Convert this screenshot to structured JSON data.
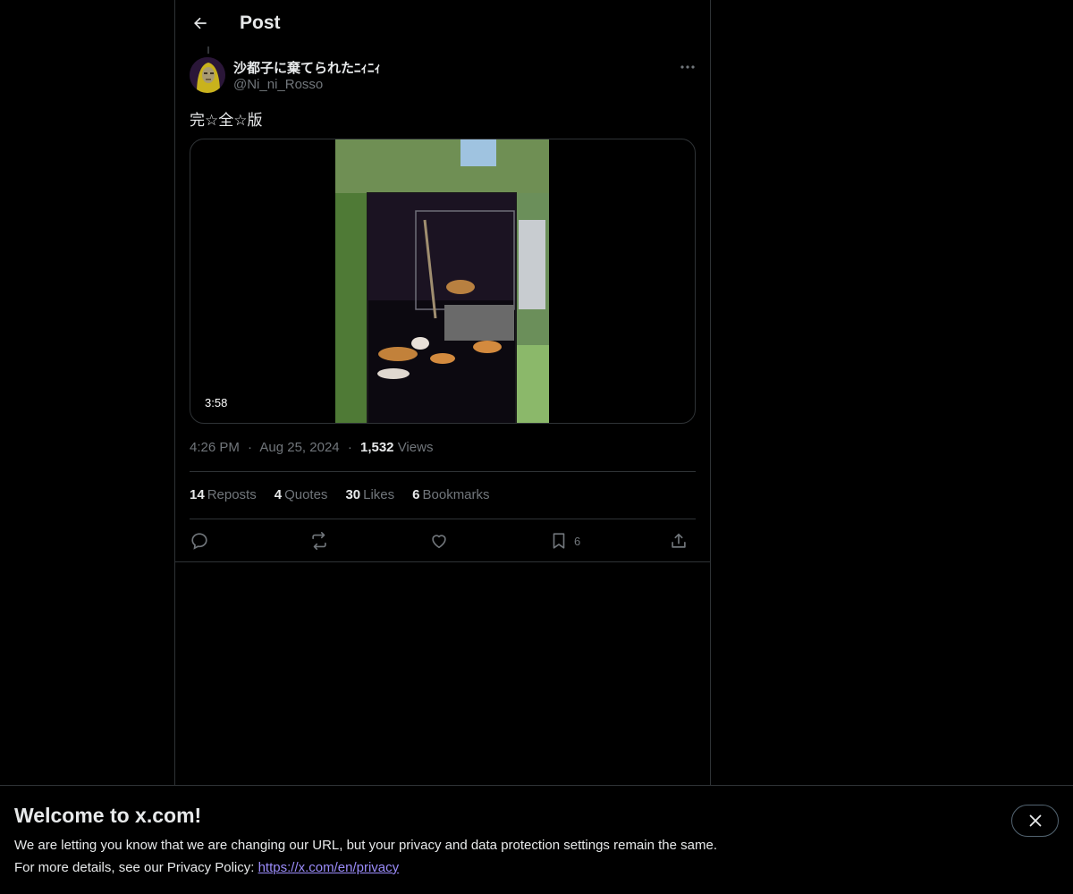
{
  "header": {
    "title": "Post",
    "back_icon": "arrow-left-icon"
  },
  "post": {
    "author_name": "沙都子に棄てられたﾆｨﾆｨ",
    "author_handle": "@Ni_ni_Rosso",
    "text": "完☆全☆版",
    "video_duration": "3:58",
    "time": "4:26 PM",
    "date": "Aug 25, 2024",
    "views_count": "1,532",
    "views_label": "Views",
    "separator": "·"
  },
  "stats": [
    {
      "count": "14",
      "label": "Reposts"
    },
    {
      "count": "4",
      "label": "Quotes"
    },
    {
      "count": "30",
      "label": "Likes"
    },
    {
      "count": "6",
      "label": "Bookmarks"
    }
  ],
  "actions": {
    "reply_icon": "reply-icon",
    "repost_icon": "repost-icon",
    "like_icon": "heart-icon",
    "bookmark_icon": "bookmark-icon",
    "bookmark_count": "6",
    "share_icon": "share-icon"
  },
  "banner": {
    "title": "Welcome to x.com!",
    "line1": "We are letting you know that we are changing our URL, but your privacy and data protection settings remain the same.",
    "line2_prefix": "For more details, see our Privacy Policy: ",
    "link": "https://x.com/en/privacy",
    "close_icon": "close-icon"
  },
  "colors": {
    "background": "#000000",
    "text": "#e7e9ea",
    "muted": "#71767b",
    "border": "#2f3336",
    "link": "#9b8cfa"
  }
}
